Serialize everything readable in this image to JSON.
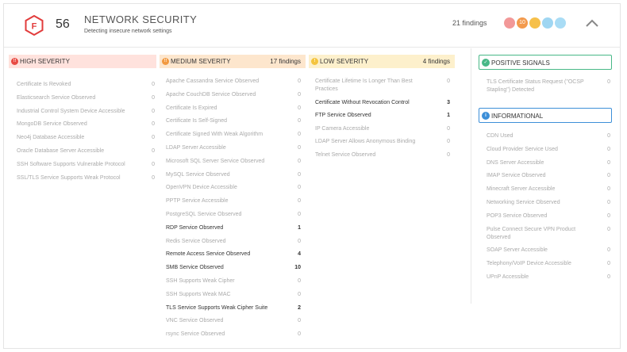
{
  "header": {
    "grade": "F",
    "score": "56",
    "title": "NETWORK SECURITY",
    "subtitle": "Detecting insecure network settings",
    "findings": "21 findings",
    "dot_labels": [
      "",
      "10",
      "",
      "",
      ""
    ],
    "colors": {
      "grade": "#e23c3c",
      "dots": [
        "#f29898",
        "#f39a4d",
        "#f6c04a",
        "#9fd6f2",
        "#a9dcf5"
      ]
    }
  },
  "high": {
    "label": "HIGH SEVERITY",
    "count": "",
    "color": "#ffe2dd",
    "icon_color": "#e84a43",
    "items": [
      {
        "name": "Certificate Is Revoked",
        "value": "0"
      },
      {
        "name": "Elasticsearch Service Observed",
        "value": "0"
      },
      {
        "name": "Industrial Control System Device Accessible",
        "value": "0"
      },
      {
        "name": "MongoDB Service Observed",
        "value": "0"
      },
      {
        "name": "Neo4j Database Accessible",
        "value": "0"
      },
      {
        "name": "Oracle Database Server Accessible",
        "value": "0"
      },
      {
        "name": "SSH Software Supports Vulnerable Protocol",
        "value": "0"
      },
      {
        "name": "SSL/TLS Service Supports Weak Protocol",
        "value": "0"
      }
    ]
  },
  "medium": {
    "label": "MEDIUM SEVERITY",
    "count": "17 findings",
    "color": "#fde6cd",
    "icon_color": "#f2993f",
    "items": [
      {
        "name": "Apache Cassandra Service Observed",
        "value": "0"
      },
      {
        "name": "Apache CouchDB Service Observed",
        "value": "0"
      },
      {
        "name": "Certificate Is Expired",
        "value": "0"
      },
      {
        "name": "Certificate Is Self-Signed",
        "value": "0"
      },
      {
        "name": "Certificate Signed With Weak Algorithm",
        "value": "0"
      },
      {
        "name": "LDAP Server Accessible",
        "value": "0"
      },
      {
        "name": "Microsoft SQL Server Service Observed",
        "value": "0"
      },
      {
        "name": "MySQL Service Observed",
        "value": "0"
      },
      {
        "name": "OpenVPN Device Accessible",
        "value": "0"
      },
      {
        "name": "PPTP Service Accessible",
        "value": "0"
      },
      {
        "name": "PostgreSQL Service Observed",
        "value": "0"
      },
      {
        "name": "RDP Service Observed",
        "value": "1"
      },
      {
        "name": "Redis Service Observed",
        "value": "0"
      },
      {
        "name": "Remote Access Service Observed",
        "value": "4"
      },
      {
        "name": "SMB Service Observed",
        "value": "10"
      },
      {
        "name": "SSH Supports Weak Cipher",
        "value": "0"
      },
      {
        "name": "SSH Supports Weak MAC",
        "value": "0"
      },
      {
        "name": "TLS Service Supports Weak Cipher Suite",
        "value": "2"
      },
      {
        "name": "VNC Service Observed",
        "value": "0"
      },
      {
        "name": "rsync Service Observed",
        "value": "0"
      }
    ]
  },
  "low": {
    "label": "LOW SEVERITY",
    "count": "4 findings",
    "color": "#fdf0cc",
    "icon_color": "#f4c43e",
    "items": [
      {
        "name": "Certificate Lifetime Is Longer Than Best",
        "name2": "Practices",
        "value": "0"
      },
      {
        "name": "Certificate Without Revocation Control",
        "value": "3"
      },
      {
        "name": "FTP Service Observed",
        "value": "1"
      },
      {
        "name": "IP Camera Accessible",
        "value": "0"
      },
      {
        "name": "LDAP Server Allows Anonymous Binding",
        "value": "0"
      },
      {
        "name": "Telnet Service Observed",
        "value": "0"
      }
    ]
  },
  "positive": {
    "label": "POSITIVE SIGNALS",
    "color": "#48b887",
    "items": [
      {
        "name": "TLS Certificate Status Request (\"OCSP",
        "name2": "Stapling\") Detected",
        "value": "0"
      }
    ]
  },
  "informational": {
    "label": "INFORMATIONAL",
    "color": "#3d8fd8",
    "items": [
      {
        "name": "CDN Used",
        "value": "0"
      },
      {
        "name": "Cloud Provider Service Used",
        "value": "0"
      },
      {
        "name": "DNS Server Accessible",
        "value": "0"
      },
      {
        "name": "IMAP Service Observed",
        "value": "0"
      },
      {
        "name": "Minecraft Server Accessible",
        "value": "0"
      },
      {
        "name": "Networking Service Observed",
        "value": "0"
      },
      {
        "name": "POP3 Service Observed",
        "value": "0"
      },
      {
        "name": "Pulse Connect Secure VPN Product",
        "name2": "Observed",
        "value": "0"
      },
      {
        "name": "SOAP Server Accessible",
        "value": "0"
      },
      {
        "name": "Telephony/VoIP Device Accessible",
        "value": "0"
      },
      {
        "name": "UPnP Accessible",
        "value": "0"
      }
    ]
  }
}
